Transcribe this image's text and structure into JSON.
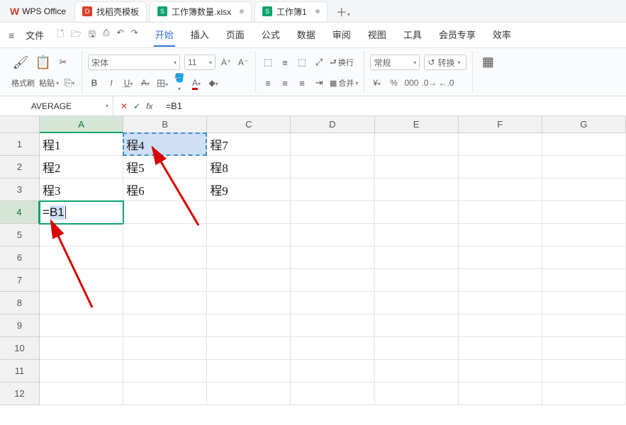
{
  "app": {
    "name": "WPS Office"
  },
  "tabs": [
    {
      "label": "找稻壳模板",
      "type": "dk"
    },
    {
      "label": "工作簿数量.xlsx",
      "type": "xs",
      "dot": true
    },
    {
      "label": "工作簿1",
      "type": "xs",
      "dot": true,
      "active": true
    }
  ],
  "menu": {
    "file": "文件",
    "items": [
      "开始",
      "插入",
      "页面",
      "公式",
      "数据",
      "审阅",
      "视图",
      "工具",
      "会员专享",
      "效率"
    ],
    "active": "开始"
  },
  "ribbon": {
    "format_painter": "格式刷",
    "paste": "粘贴",
    "font_name": "宋体",
    "font_size": "11",
    "wrap": "换行",
    "merge": "合并",
    "number_format": "常规",
    "convert": "转换"
  },
  "formula": {
    "namebox": "AVERAGE",
    "value": "=B1"
  },
  "columns": [
    "A",
    "B",
    "C",
    "D",
    "E",
    "F",
    "G"
  ],
  "rows": [
    "1",
    "2",
    "3",
    "4",
    "5",
    "6",
    "7",
    "8",
    "9",
    "10",
    "11",
    "12"
  ],
  "data": {
    "A1": "程1",
    "B1": "程4",
    "C1": "程7",
    "A2": "程2",
    "B2": "程5",
    "C2": "程8",
    "A3": "程3",
    "B3": "程6",
    "C3": "程9",
    "A4": "=B1"
  },
  "active_cell": "A4",
  "marquee_cell": "B1",
  "active_col": "A",
  "active_row": "4"
}
